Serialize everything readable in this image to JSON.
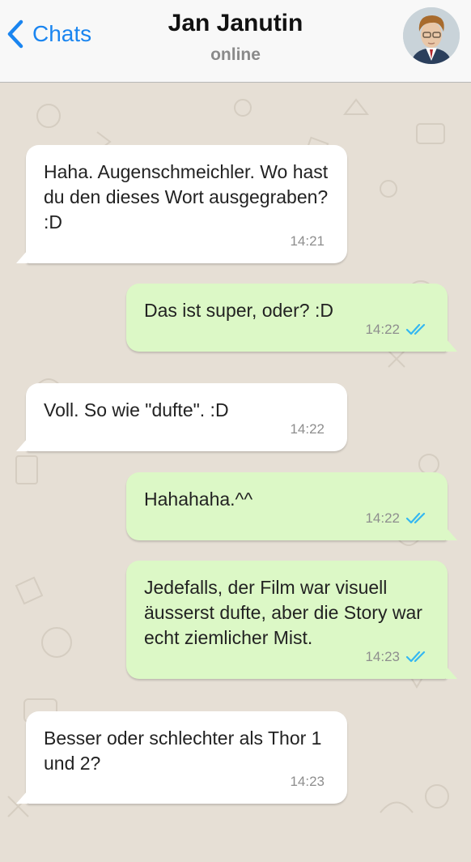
{
  "header": {
    "back_label": "Chats",
    "contact_name": "Jan Janutin",
    "status": "online"
  },
  "colors": {
    "accent": "#1a85f0",
    "incoming_bubble": "#ffffff",
    "outgoing_bubble": "#dcf8c6",
    "read_ticks": "#34b7f1"
  },
  "icons": {
    "back": "chevron-left-icon",
    "read_receipt": "double-check-icon"
  },
  "messages": [
    {
      "direction": "in",
      "text": "Haha. Augenschmeichler. Wo hast du den dieses Wort ausgegraben? :D",
      "time": "14:21"
    },
    {
      "direction": "out",
      "text": "Das ist super, oder? :D",
      "time": "14:22",
      "status": "read"
    },
    {
      "direction": "in",
      "text": "Voll. So wie \"dufte\". :D",
      "time": "14:22"
    },
    {
      "direction": "out",
      "text": "Hahahaha.^^",
      "time": "14:22",
      "status": "read"
    },
    {
      "direction": "out",
      "text": "Jedefalls, der Film war visuell äusserst dufte, aber die Story war echt ziemlicher Mist.",
      "time": "14:23",
      "status": "read"
    },
    {
      "direction": "in",
      "text": "Besser oder schlechter als Thor 1 und 2?",
      "time": "14:23"
    }
  ]
}
